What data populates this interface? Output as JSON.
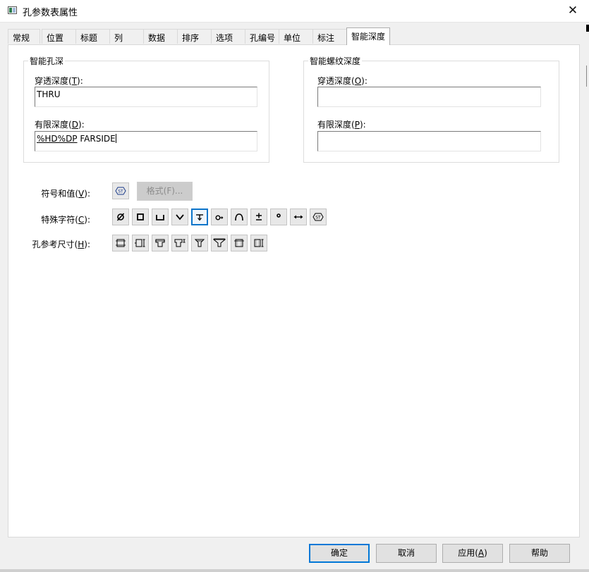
{
  "window": {
    "title": "孔参数表属性",
    "close_glyph": "✕"
  },
  "tabs": [
    {
      "label": "常规"
    },
    {
      "label": "位置"
    },
    {
      "label": "标题"
    },
    {
      "label": "列"
    },
    {
      "label": "数据"
    },
    {
      "label": "排序"
    },
    {
      "label": "选项"
    },
    {
      "label": "孔编号"
    },
    {
      "label": "单位"
    },
    {
      "label": "标注"
    },
    {
      "label": "智能深度",
      "active": true
    }
  ],
  "smart_hole_depth": {
    "title": "智能孔深",
    "thru_label": "穿透深度(",
    "thru_key": "T",
    "thru_suffix": "):",
    "thru_value": "THRU",
    "limited_label": "有限深度(",
    "limited_key": "D",
    "limited_suffix": "):",
    "limited_value_prefix": "%HD%DP",
    "limited_value_rest": " FARSIDE"
  },
  "smart_thread_depth": {
    "title": "智能螺纹深度",
    "thru_label": "穿透深度(",
    "thru_key": "O",
    "thru_suffix": "):",
    "thru_value": "",
    "limited_label": "有限深度(",
    "limited_key": "P",
    "limited_suffix": "):",
    "limited_value": ""
  },
  "symbols": {
    "symbol_value_label": "符号和值(",
    "symbol_value_key": "V",
    "symbol_value_suffix": "):",
    "format_button": "格式(F)...",
    "special_chars_label": "特殊字符(",
    "special_chars_key": "C",
    "special_chars_suffix": "):",
    "hole_ref_label": "孔参考尺寸(",
    "hole_ref_key": "H",
    "hole_ref_suffix": "):",
    "special_chars": [
      {
        "icon": "diameter-icon"
      },
      {
        "icon": "square-icon"
      },
      {
        "icon": "counterbore-icon"
      },
      {
        "icon": "countersink-icon"
      },
      {
        "icon": "depth-icon",
        "selected": true
      },
      {
        "icon": "arc-length-icon"
      },
      {
        "icon": "arc-icon"
      },
      {
        "icon": "plus-minus-icon"
      },
      {
        "icon": "degree-icon"
      },
      {
        "icon": "between-icon"
      },
      {
        "icon": "thread-symbol-icon"
      }
    ],
    "hole_refs": [
      {
        "icon": "hole-diameter-ref-icon"
      },
      {
        "icon": "hole-depth-ref-icon"
      },
      {
        "icon": "counterbore-diameter-ref-icon"
      },
      {
        "icon": "counterbore-depth-ref-icon"
      },
      {
        "icon": "countersink-angle-ref-icon"
      },
      {
        "icon": "countersink-diameter-ref-icon"
      },
      {
        "icon": "thread-diameter-ref-icon"
      },
      {
        "icon": "thread-depth-ref-icon"
      }
    ]
  },
  "buttons": {
    "ok": "确定",
    "cancel": "取消",
    "apply_label": "应用(",
    "apply_key": "A",
    "apply_suffix": ")",
    "help": "帮助"
  }
}
